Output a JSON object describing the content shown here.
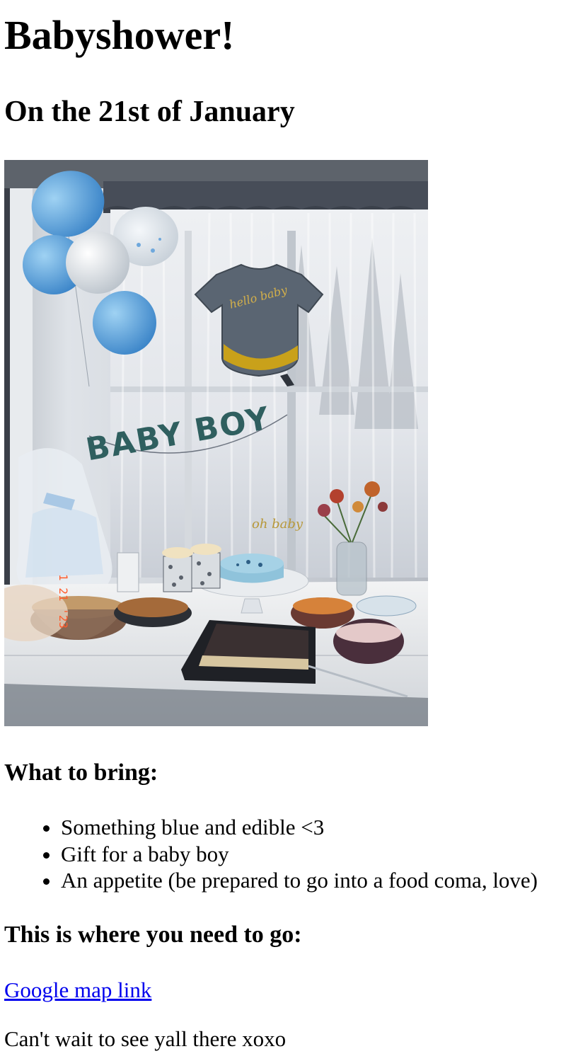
{
  "page": {
    "title": "Babyshower!",
    "subtitle": "On the 21st of January"
  },
  "photo": {
    "banner_text": "BABY BOY",
    "topper_text": "oh baby",
    "timestamp": "1 21 '23"
  },
  "bring": {
    "heading": "What to bring:",
    "items": [
      "Something blue and edible <3",
      "Gift for a baby boy",
      "An appetite (be prepared to go into a food coma, love)"
    ]
  },
  "location": {
    "heading": "This is where you need to go:",
    "link_text": "Google map link"
  },
  "closing": "Can't wait to see yall there xoxo",
  "colors": {
    "link": "#0000ee",
    "text": "#000000",
    "banner": "#2f5f5f"
  }
}
